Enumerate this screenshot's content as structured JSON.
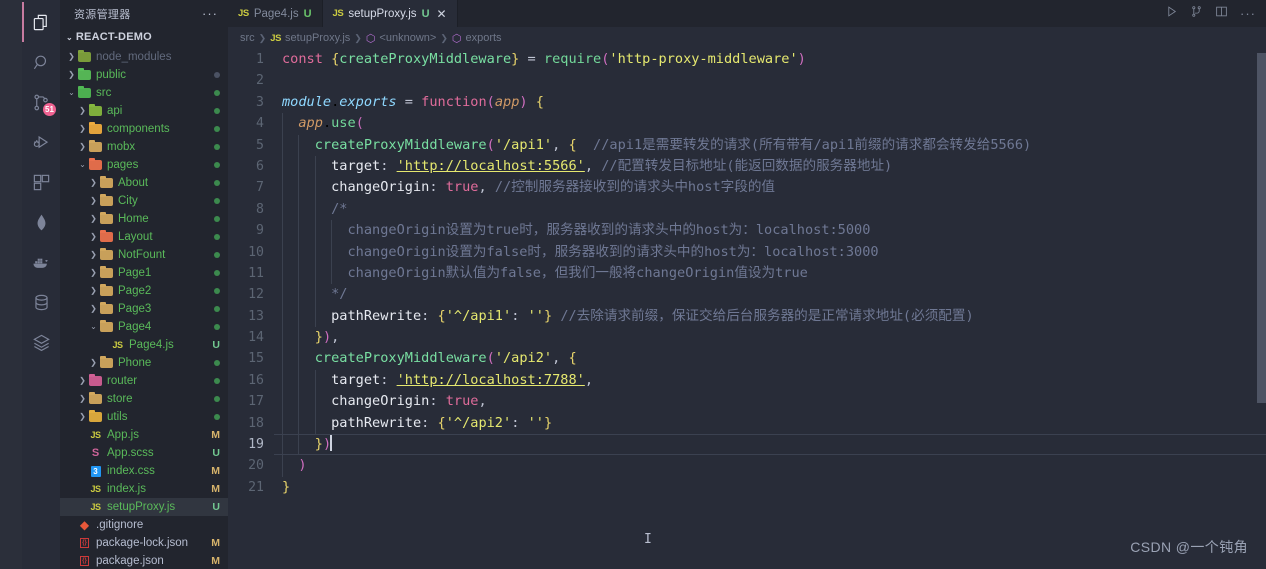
{
  "activitybar": {
    "items": [
      {
        "name": "explorer-icon",
        "active": true,
        "badge": null
      },
      {
        "name": "search-icon",
        "active": false,
        "badge": null
      },
      {
        "name": "source-control-icon",
        "active": false,
        "badge": "51"
      },
      {
        "name": "run-and-debug-icon",
        "active": false,
        "badge": null
      },
      {
        "name": "extensions-icon",
        "active": false,
        "badge": null
      },
      {
        "name": "mongodb-icon",
        "active": false,
        "badge": null
      },
      {
        "name": "docker-icon",
        "active": false,
        "badge": null
      },
      {
        "name": "database-icon",
        "active": false,
        "badge": null
      },
      {
        "name": "layers-icon",
        "active": false,
        "badge": null
      }
    ]
  },
  "sidebar": {
    "title": "资源管理器",
    "more_label": "···",
    "project": "REACT-DEMO",
    "tree": [
      {
        "label": "node_modules",
        "indent": 0,
        "twisty": "collapsed",
        "icon": "folder-node",
        "color": "#6e7687",
        "status": "",
        "dot": ""
      },
      {
        "label": "public",
        "indent": 0,
        "twisty": "collapsed",
        "icon": "folder-public",
        "color": "#5aba5a",
        "status": "",
        "dot": "grey"
      },
      {
        "label": "src",
        "indent": 0,
        "twisty": "expanded",
        "icon": "folder-src",
        "color": "#5aba5a",
        "status": "",
        "dot": "green"
      },
      {
        "label": "api",
        "indent": 1,
        "twisty": "collapsed",
        "icon": "folder-api",
        "color": "#5aba5a",
        "status": "",
        "dot": "green"
      },
      {
        "label": "components",
        "indent": 1,
        "twisty": "collapsed",
        "icon": "folder-components",
        "color": "#5aba5a",
        "status": "",
        "dot": "green"
      },
      {
        "label": "mobx",
        "indent": 1,
        "twisty": "collapsed",
        "icon": "folder-plain",
        "color": "#5aba5a",
        "status": "",
        "dot": "green"
      },
      {
        "label": "pages",
        "indent": 1,
        "twisty": "expanded",
        "icon": "folder-pages",
        "color": "#5aba5a",
        "status": "",
        "dot": "green"
      },
      {
        "label": "About",
        "indent": 2,
        "twisty": "collapsed",
        "icon": "folder-plain",
        "color": "#5aba5a",
        "status": "",
        "dot": "green"
      },
      {
        "label": "City",
        "indent": 2,
        "twisty": "collapsed",
        "icon": "folder-plain",
        "color": "#5aba5a",
        "status": "",
        "dot": "green"
      },
      {
        "label": "Home",
        "indent": 2,
        "twisty": "collapsed",
        "icon": "folder-plain",
        "color": "#5aba5a",
        "status": "",
        "dot": "green"
      },
      {
        "label": "Layout",
        "indent": 2,
        "twisty": "collapsed",
        "icon": "folder-layout",
        "color": "#5aba5a",
        "status": "",
        "dot": "green"
      },
      {
        "label": "NotFount",
        "indent": 2,
        "twisty": "collapsed",
        "icon": "folder-plain",
        "color": "#5aba5a",
        "status": "",
        "dot": "green"
      },
      {
        "label": "Page1",
        "indent": 2,
        "twisty": "collapsed",
        "icon": "folder-plain",
        "color": "#5aba5a",
        "status": "",
        "dot": "green"
      },
      {
        "label": "Page2",
        "indent": 2,
        "twisty": "collapsed",
        "icon": "folder-plain",
        "color": "#5aba5a",
        "status": "",
        "dot": "green"
      },
      {
        "label": "Page3",
        "indent": 2,
        "twisty": "collapsed",
        "icon": "folder-plain",
        "color": "#5aba5a",
        "status": "",
        "dot": "green"
      },
      {
        "label": "Page4",
        "indent": 2,
        "twisty": "expanded",
        "icon": "folder-plain",
        "color": "#5aba5a",
        "status": "",
        "dot": "green"
      },
      {
        "label": "Page4.js",
        "indent": 3,
        "twisty": "none",
        "icon": "js-file",
        "color": "#5aba5a",
        "status": "U",
        "dot": ""
      },
      {
        "label": "Phone",
        "indent": 2,
        "twisty": "collapsed",
        "icon": "folder-plain",
        "color": "#5aba5a",
        "status": "",
        "dot": "green"
      },
      {
        "label": "router",
        "indent": 1,
        "twisty": "collapsed",
        "icon": "folder-router",
        "color": "#5aba5a",
        "status": "",
        "dot": "green"
      },
      {
        "label": "store",
        "indent": 1,
        "twisty": "collapsed",
        "icon": "folder-plain",
        "color": "#5aba5a",
        "status": "",
        "dot": "green"
      },
      {
        "label": "utils",
        "indent": 1,
        "twisty": "collapsed",
        "icon": "folder-utils",
        "color": "#5aba5a",
        "status": "",
        "dot": "green"
      },
      {
        "label": "App.js",
        "indent": 1,
        "twisty": "none",
        "icon": "js-file",
        "color": "#5aba5a",
        "status": "M",
        "dot": ""
      },
      {
        "label": "App.scss",
        "indent": 1,
        "twisty": "none",
        "icon": "sass-file",
        "color": "#5aba5a",
        "status": "U",
        "dot": ""
      },
      {
        "label": "index.css",
        "indent": 1,
        "twisty": "none",
        "icon": "css-file",
        "color": "#5aba5a",
        "status": "M",
        "dot": ""
      },
      {
        "label": "index.js",
        "indent": 1,
        "twisty": "none",
        "icon": "js-file",
        "color": "#5aba5a",
        "status": "M",
        "dot": ""
      },
      {
        "label": "setupProxy.js",
        "indent": 1,
        "twisty": "none",
        "icon": "js-file",
        "color": "#5aba5a",
        "status": "U",
        "dot": "",
        "selected": true
      },
      {
        "label": ".gitignore",
        "indent": 0,
        "twisty": "none",
        "icon": "git-file",
        "color": "#b6bdd0",
        "status": "",
        "dot": ""
      },
      {
        "label": "package-lock.json",
        "indent": 0,
        "twisty": "none",
        "icon": "json-file",
        "color": "#b6bdd0",
        "status": "M",
        "dot": ""
      },
      {
        "label": "package.json",
        "indent": 0,
        "twisty": "none",
        "icon": "json-file",
        "color": "#b6bdd0",
        "status": "M",
        "dot": ""
      }
    ]
  },
  "tabs": [
    {
      "label": "Page4.js",
      "icon": "js-file-icon",
      "status": "U",
      "active": false,
      "closable": false
    },
    {
      "label": "setupProxy.js",
      "icon": "js-file-icon",
      "status": "U",
      "active": true,
      "closable": true
    }
  ],
  "editor_actions": [
    {
      "name": "run-icon",
      "glyph": "▷"
    },
    {
      "name": "split-source-control-icon",
      "glyph": "⑂"
    },
    {
      "name": "split-editor-icon",
      "glyph": "▯"
    },
    {
      "name": "more-actions-icon",
      "glyph": "···"
    }
  ],
  "breadcrumb": [
    {
      "label": "src",
      "icon": ""
    },
    {
      "label": "setupProxy.js",
      "icon": "js"
    },
    {
      "label": "<unknown>",
      "icon": "cube"
    },
    {
      "label": "exports",
      "icon": "cube"
    }
  ],
  "editor": {
    "filename": "setupProxy.js",
    "current_line": 19,
    "total_lines": 21,
    "lines": [
      {
        "n": 1,
        "text": "const {createProxyMiddleware} = require('http-proxy-middleware')"
      },
      {
        "n": 2,
        "text": ""
      },
      {
        "n": 3,
        "text": "module.exports = function(app) {"
      },
      {
        "n": 4,
        "text": "  app.use("
      },
      {
        "n": 5,
        "text": "    createProxyMiddleware('/api1', {  //api1是需要转发的请求(所有带有/api1前缀的请求都会转发给5566)"
      },
      {
        "n": 6,
        "text": "      target: 'http://localhost:5566', //配置转发目标地址(能返回数据的服务器地址)"
      },
      {
        "n": 7,
        "text": "      changeOrigin: true, //控制服务器接收到的请求头中host字段的值"
      },
      {
        "n": 8,
        "text": "      /*"
      },
      {
        "n": 9,
        "text": "        changeOrigin设置为true时，服务器收到的请求头中的host为：localhost:5000"
      },
      {
        "n": 10,
        "text": "        changeOrigin设置为false时，服务器收到的请求头中的host为：localhost:3000"
      },
      {
        "n": 11,
        "text": "        changeOrigin默认值为false，但我们一般将changeOrigin值设为true"
      },
      {
        "n": 12,
        "text": "      */"
      },
      {
        "n": 13,
        "text": "      pathRewrite: {'^/api1': ''} //去除请求前缀，保证交给后台服务器的是正常请求地址(必须配置)"
      },
      {
        "n": 14,
        "text": "    }),"
      },
      {
        "n": 15,
        "text": "    createProxyMiddleware('/api2', {"
      },
      {
        "n": 16,
        "text": "      target: 'http://localhost:7788',"
      },
      {
        "n": 17,
        "text": "      changeOrigin: true,"
      },
      {
        "n": 18,
        "text": "      pathRewrite: {'^/api2': ''}"
      },
      {
        "n": 19,
        "text": "    })"
      },
      {
        "n": 20,
        "text": "  )"
      },
      {
        "n": 21,
        "text": "}"
      }
    ]
  },
  "watermark": "CSDN @一个钝角",
  "colors": {
    "editor_bg": "#282c38",
    "sidebar_bg": "#22252e",
    "accent": "#c77ba0",
    "badge": "#f06292",
    "keyword": "#e06c9b",
    "string": "#e5e86f",
    "comment": "#6f7894",
    "function": "#73d99a"
  }
}
